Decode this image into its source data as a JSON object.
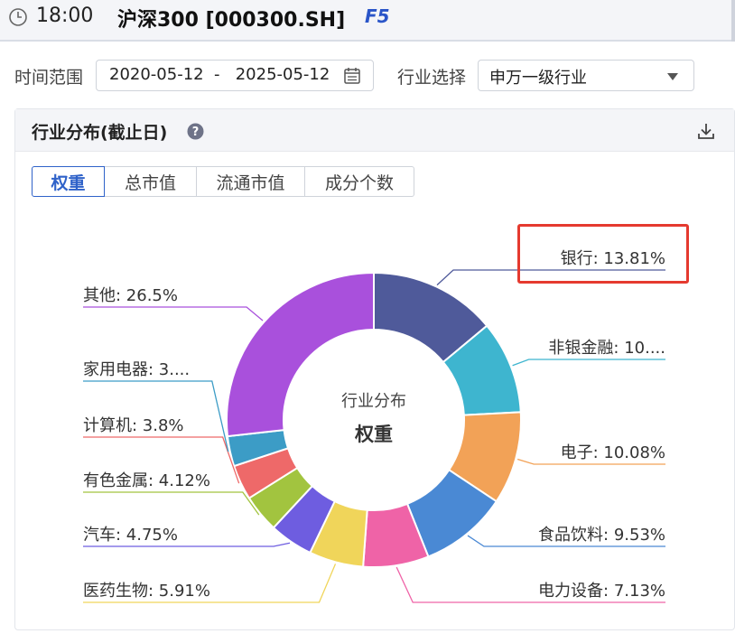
{
  "topbar": {
    "time": "18:00",
    "title": "沪深300 [000300.SH]",
    "f5": "F5"
  },
  "filters": {
    "date_label": "时间范围",
    "date_range": "2020-05-12  -   2025-05-12",
    "industry_label": "行业选择",
    "industry_value": "申万一级行业"
  },
  "panel": {
    "title": "行业分布(截止日)",
    "tabs": [
      "权重",
      "总市值",
      "流通市值",
      "成分个数"
    ],
    "active_tab": 0
  },
  "chart_data": {
    "type": "pie",
    "center_title": "行业分布",
    "center_subtitle": "权重",
    "slices": [
      {
        "label": "银行: 13.81%",
        "value": 13.81,
        "color": "#4f5a9a"
      },
      {
        "label": "非银金融: 10....",
        "value": 10.1,
        "color": "#3eb5cf"
      },
      {
        "label": "电子: 10.08%",
        "value": 10.08,
        "color": "#f2a257"
      },
      {
        "label": "食品饮料: 9.53%",
        "value": 9.53,
        "color": "#4a89d4"
      },
      {
        "label": "电力设备: 7.13%",
        "value": 7.13,
        "color": "#ef63a7"
      },
      {
        "label": "医药生物: 5.91%",
        "value": 5.91,
        "color": "#f0d55a"
      },
      {
        "label": "汽车: 4.75%",
        "value": 4.75,
        "color": "#6e5de0"
      },
      {
        "label": "有色金属: 4.12%",
        "value": 4.12,
        "color": "#a2c43f"
      },
      {
        "label": "计算机: 3.8%",
        "value": 3.8,
        "color": "#ee6969"
      },
      {
        "label": "家用电器: 3....",
        "value": 3.27,
        "color": "#3c9cc6"
      },
      {
        "label": "其他: 26.5%",
        "value": 26.5,
        "color": "#a950dc"
      }
    ],
    "highlight_color": "#e53a2f"
  }
}
